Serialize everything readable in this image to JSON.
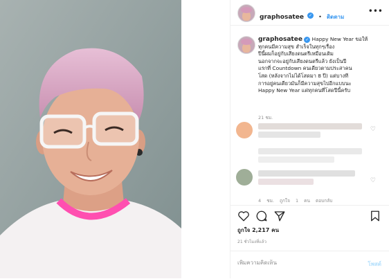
{
  "header": {
    "username": "graphosatee",
    "separator": "•",
    "follow_label": "ติดตาม",
    "more_icon": "more-horizontal-icon",
    "verified_icon": "verified-badge-icon"
  },
  "caption": {
    "username": "graphosatee",
    "lines": [
      "Happy New Year ขอให้",
      "ทุกคนมีความสุข สำเร็จในทุกๆเรื่อง",
      "ปีนี้ผมก็อยู่กับเสียงดนตรีเหมือนเดิม",
      "นอกจากจะอยู่กับเสียงดนตรีแล้ว ยังเป็นปี",
      "แรกที่ Countdown คนเดียวตามประสาคน",
      "โสด (หลังจากไม่ได้โสดมา 8 ปี) แต่บางที",
      "การอยู่คนเดียวมันก็มีความสุขไปอีกแบบนะ",
      "Happy New Year แด่ทุกคนที่โสดปีนี้ครับ"
    ],
    "time": "21 ชม."
  },
  "comments_meta": {
    "time": "4 ชม.",
    "likes": "ถูกใจ 1 คน",
    "reply": "ตอบกลับ"
  },
  "actions": {
    "like_icon": "heart-icon",
    "comment_icon": "comment-icon",
    "share_icon": "share-icon",
    "save_icon": "bookmark-icon"
  },
  "likes_text": "ถูกใจ 2,217 คน",
  "post_time": "21 ชั่วโมงที่แล้ว",
  "add_comment": {
    "placeholder": "เพิ่มความคิดเห็น",
    "post_label": "โพสต์"
  },
  "colors": {
    "accent": "#3897f0",
    "hair": "#d9a3c4",
    "shirt_collar": "#ff4fb0"
  }
}
